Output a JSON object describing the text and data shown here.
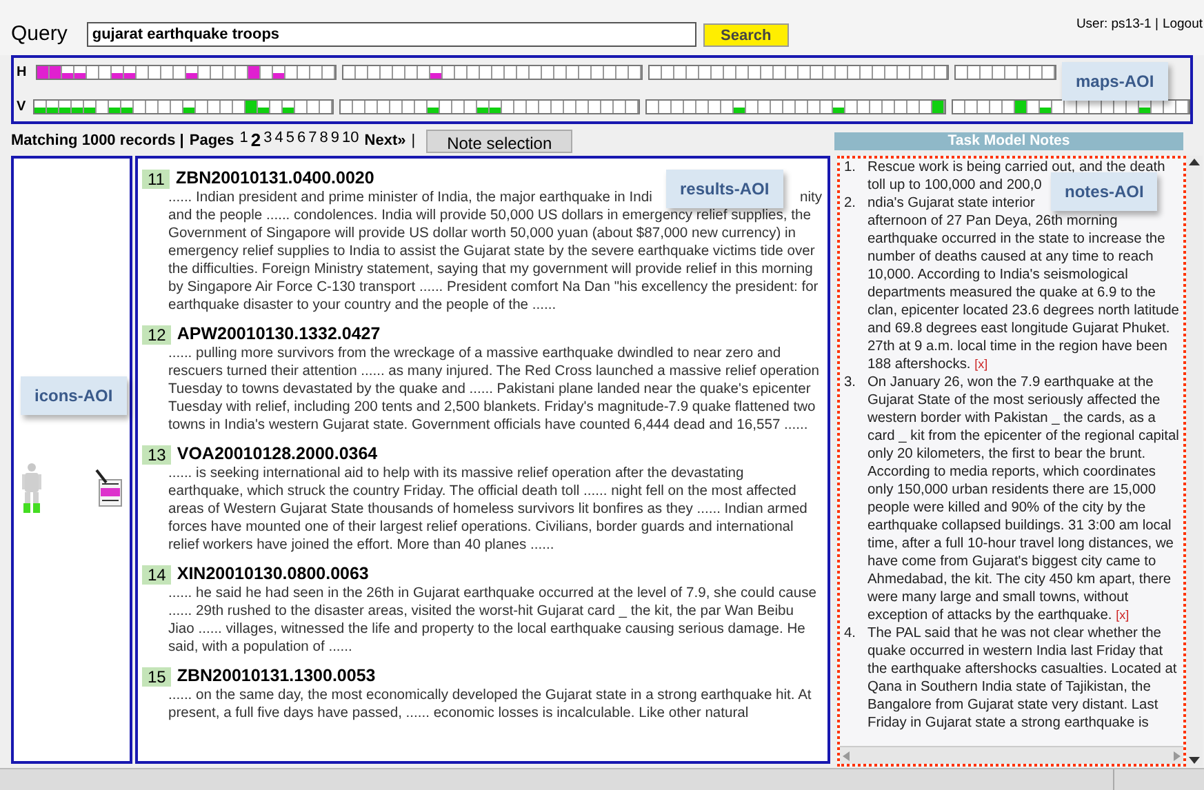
{
  "query": {
    "label": "Query",
    "value": "gujarat earthquake troops",
    "button": "Search"
  },
  "user": {
    "text": "User: ps13-1 |",
    "logout": "Logout"
  },
  "maps": [
    {
      "label": "H",
      "color": "#e020d0",
      "groups": [
        [
          {
            "kind": "full"
          },
          {
            "kind": "full"
          },
          {
            "kind": "half"
          },
          {
            "kind": "half"
          },
          {
            "kind": "empty"
          },
          {
            "kind": "empty"
          },
          {
            "kind": "half"
          },
          {
            "kind": "half"
          },
          {
            "kind": "empty"
          },
          {
            "kind": "empty"
          },
          {
            "kind": "empty"
          },
          {
            "kind": "empty"
          },
          {
            "kind": "half"
          },
          {
            "kind": "empty"
          },
          {
            "kind": "empty"
          },
          {
            "kind": "empty"
          },
          {
            "kind": "empty"
          },
          {
            "kind": "full"
          },
          {
            "kind": "empty"
          },
          {
            "kind": "half"
          },
          {
            "kind": "empty"
          },
          {
            "kind": "empty"
          },
          {
            "kind": "empty"
          },
          {
            "kind": "empty"
          }
        ],
        [
          {
            "kind": "empty"
          },
          {
            "kind": "empty"
          },
          {
            "kind": "empty"
          },
          {
            "kind": "empty"
          },
          {
            "kind": "empty"
          },
          {
            "kind": "empty"
          },
          {
            "kind": "empty"
          },
          {
            "kind": "half"
          },
          {
            "kind": "empty"
          },
          {
            "kind": "empty"
          },
          {
            "kind": "empty"
          },
          {
            "kind": "empty"
          },
          {
            "kind": "empty"
          },
          {
            "kind": "empty"
          },
          {
            "kind": "empty"
          },
          {
            "kind": "empty"
          },
          {
            "kind": "empty"
          },
          {
            "kind": "empty"
          },
          {
            "kind": "empty"
          },
          {
            "kind": "empty"
          },
          {
            "kind": "empty"
          },
          {
            "kind": "empty"
          },
          {
            "kind": "empty"
          },
          {
            "kind": "empty"
          }
        ],
        [
          {
            "kind": "empty"
          },
          {
            "kind": "empty"
          },
          {
            "kind": "empty"
          },
          {
            "kind": "empty"
          },
          {
            "kind": "empty"
          },
          {
            "kind": "empty"
          },
          {
            "kind": "empty"
          },
          {
            "kind": "empty"
          },
          {
            "kind": "empty"
          },
          {
            "kind": "empty"
          },
          {
            "kind": "empty"
          },
          {
            "kind": "empty"
          },
          {
            "kind": "empty"
          },
          {
            "kind": "empty"
          },
          {
            "kind": "empty"
          },
          {
            "kind": "empty"
          },
          {
            "kind": "empty"
          },
          {
            "kind": "empty"
          },
          {
            "kind": "empty"
          },
          {
            "kind": "empty"
          },
          {
            "kind": "empty"
          },
          {
            "kind": "empty"
          },
          {
            "kind": "empty"
          },
          {
            "kind": "empty"
          }
        ],
        [
          {
            "kind": "empty"
          },
          {
            "kind": "empty"
          },
          {
            "kind": "empty"
          },
          {
            "kind": "empty"
          },
          {
            "kind": "empty"
          },
          {
            "kind": "empty"
          },
          {
            "kind": "empty"
          },
          {
            "kind": "empty"
          }
        ]
      ]
    },
    {
      "label": "V",
      "color": "#10d010",
      "groups": [
        [
          {
            "kind": "half"
          },
          {
            "kind": "half"
          },
          {
            "kind": "half"
          },
          {
            "kind": "half"
          },
          {
            "kind": "half"
          },
          {
            "kind": "empty"
          },
          {
            "kind": "half"
          },
          {
            "kind": "half"
          },
          {
            "kind": "empty"
          },
          {
            "kind": "empty"
          },
          {
            "kind": "empty"
          },
          {
            "kind": "empty"
          },
          {
            "kind": "half"
          },
          {
            "kind": "empty"
          },
          {
            "kind": "empty"
          },
          {
            "kind": "empty"
          },
          {
            "kind": "empty"
          },
          {
            "kind": "full"
          },
          {
            "kind": "half"
          },
          {
            "kind": "empty"
          },
          {
            "kind": "half"
          },
          {
            "kind": "empty"
          },
          {
            "kind": "empty"
          },
          {
            "kind": "empty"
          }
        ],
        [
          {
            "kind": "empty"
          },
          {
            "kind": "empty"
          },
          {
            "kind": "empty"
          },
          {
            "kind": "empty"
          },
          {
            "kind": "empty"
          },
          {
            "kind": "empty"
          },
          {
            "kind": "empty"
          },
          {
            "kind": "half"
          },
          {
            "kind": "empty"
          },
          {
            "kind": "empty"
          },
          {
            "kind": "empty"
          },
          {
            "kind": "half"
          },
          {
            "kind": "half"
          },
          {
            "kind": "empty"
          },
          {
            "kind": "empty"
          },
          {
            "kind": "empty"
          },
          {
            "kind": "empty"
          },
          {
            "kind": "empty"
          },
          {
            "kind": "empty"
          },
          {
            "kind": "empty"
          },
          {
            "kind": "empty"
          },
          {
            "kind": "empty"
          },
          {
            "kind": "empty"
          },
          {
            "kind": "empty"
          }
        ],
        [
          {
            "kind": "empty"
          },
          {
            "kind": "empty"
          },
          {
            "kind": "empty"
          },
          {
            "kind": "empty"
          },
          {
            "kind": "empty"
          },
          {
            "kind": "empty"
          },
          {
            "kind": "empty"
          },
          {
            "kind": "half"
          },
          {
            "kind": "empty"
          },
          {
            "kind": "empty"
          },
          {
            "kind": "empty"
          },
          {
            "kind": "empty"
          },
          {
            "kind": "empty"
          },
          {
            "kind": "empty"
          },
          {
            "kind": "empty"
          },
          {
            "kind": "half"
          },
          {
            "kind": "empty"
          },
          {
            "kind": "empty"
          },
          {
            "kind": "empty"
          },
          {
            "kind": "empty"
          },
          {
            "kind": "empty"
          },
          {
            "kind": "empty"
          },
          {
            "kind": "empty"
          },
          {
            "kind": "full"
          }
        ],
        [
          {
            "kind": "empty"
          },
          {
            "kind": "empty"
          },
          {
            "kind": "empty"
          },
          {
            "kind": "empty"
          },
          {
            "kind": "empty"
          },
          {
            "kind": "full"
          },
          {
            "kind": "empty"
          },
          {
            "kind": "half"
          },
          {
            "kind": "empty"
          },
          {
            "kind": "empty"
          },
          {
            "kind": "empty"
          },
          {
            "kind": "empty"
          },
          {
            "kind": "empty"
          },
          {
            "kind": "empty"
          },
          {
            "kind": "empty"
          },
          {
            "kind": "half"
          },
          {
            "kind": "empty"
          },
          {
            "kind": "empty"
          },
          {
            "kind": "empty"
          }
        ]
      ]
    }
  ],
  "pager": {
    "summary": "Matching 1000 records |",
    "pages_label": "Pages",
    "pages": [
      {
        "label": "1",
        "selected": false
      },
      {
        "label": "2",
        "selected": true
      },
      {
        "label": "3",
        "selected": false
      },
      {
        "label": "4",
        "selected": false
      },
      {
        "label": "5",
        "selected": false
      },
      {
        "label": "6",
        "selected": false
      },
      {
        "label": "7",
        "selected": false
      },
      {
        "label": "8",
        "selected": false
      },
      {
        "label": "9",
        "selected": false
      },
      {
        "label": "10",
        "selected": false
      }
    ],
    "next": "Next»",
    "separator": "|",
    "note_button": "Note selection"
  },
  "results": [
    {
      "number": "11",
      "doc_id": "ZBN20010131.0400.0020",
      "lead": [
        "...... Indian president and prime minister of India, the major earthquake in Indi",
        "nity"
      ],
      "snippet": "and the people ...... condolences. India will provide 50,000 US dollars in emergency relief supplies, the Government of Singapore will provide US dollar worth 50,000 yuan (about $87,000 new currency) in emergency relief supplies to India to assist the Gujarat state by the severe earthquake victims tide over the difficulties. Foreign Ministry statement, saying that my government will provide relief in this morning by Singapore Air Force C-130 transport ...... President comfort Na Dan \"his excellency the president: for earthquake disaster to your country and the people of the ......"
    },
    {
      "number": "12",
      "doc_id": "APW20010130.1332.0427",
      "snippet": "...... pulling more survivors from the wreckage of a massive earthquake dwindled to near zero and rescuers turned their attention ...... as many injured. The Red Cross launched a massive relief operation Tuesday to towns devastated by the quake and ...... Pakistani plane landed near the quake's epicenter Tuesday with relief, including 200 tents and 2,500 blankets. Friday's magnitude-7.9 quake flattened two towns in India's western Gujarat state. Government officials have counted 6,444 dead and 16,557 ......"
    },
    {
      "number": "13",
      "doc_id": "VOA20010128.2000.0364",
      "snippet": "...... is seeking international aid to help with its massive relief operation after the devastating earthquake, which struck the country Friday. The official death toll ...... night fell on the most affected areas of Western Gujarat State thousands of homeless survivors lit bonfires as they ...... Indian armed forces have mounted one of their largest relief operations. Civilians, border guards and international relief workers have joined the effort. More than 40 planes ......"
    },
    {
      "number": "14",
      "doc_id": "XIN20010130.0800.0063",
      "snippet": "...... he said he had seen in the 26th in Gujarat earthquake occurred at the level of 7.9, she could cause ...... 29th rushed to the disaster areas, visited the worst-hit Gujarat card _ the kit, the par Wan Beibu Jiao ...... villages, witnessed the life and property to the local earthquake causing serious damage. He said, with a population of ......"
    },
    {
      "number": "15",
      "doc_id": "ZBN20010131.1300.0053",
      "snippet": "...... on the same day, the most economically developed the Gujarat state in a strong earthquake hit. At present, a full five days have passed, ...... economic losses is incalculable. Like other natural"
    }
  ],
  "notes": {
    "title": "Task Model Notes",
    "items": [
      {
        "number": "1.",
        "lead": "Rescue work is being carried out, and the death",
        "text": "toll up to 100,000 and 200,0"
      },
      {
        "number": "2.",
        "lead": "ndia's Gujarat state interior",
        "text": "afternoon of 27 Pan Deya, 26th morning earthquake occurred in the state to increase the number of deaths caused at any time to reach 10,000. According to India's seismological departments measured the quake at 6.9 to the clan, epicenter located 23.6 degrees north latitude and 69.8 degrees east longitude Gujarat Phuket. 27th at 9 a.m. local time in the region have been 188 aftershocks.",
        "delete": "[x]"
      },
      {
        "number": "3.",
        "text": "On January 26, won the 7.9 earthquake at the Gujarat State of the most seriously affected the western border with Pakistan _ the cards, as a card _ kit from the epicenter of the regional capital only 20 kilometers, the first to bear the brunt. According to media reports, which coordinates only 150,000 urban residents there are 15,000 people were killed and 90% of the city by the earthquake collapsed buildings. 31 3:00 am local time, after a full 10-hour travel long distances, we have come from Gujarat's biggest city came to Ahmedabad, the kit. The city 450 km apart, there were many large and small towns, without exception of attacks by the earthquake.",
        "delete": "[x]"
      },
      {
        "number": "4.",
        "text": "The PAL said that he was not clear whether the quake occurred in western India last Friday that the earthquake aftershocks casualties. Located at Qana in Southern India state of Tajikistan, the Bangalore from Gujarat state very distant. Last Friday in Gujarat state a strong earthquake is"
      }
    ]
  },
  "aoi_labels": [
    {
      "kind": "maps",
      "text": "maps-AOI"
    },
    {
      "kind": "results",
      "text": "results-AOI"
    },
    {
      "kind": "notes",
      "text": "notes-AOI"
    },
    {
      "kind": "icons",
      "text": "icons-AOI"
    }
  ]
}
